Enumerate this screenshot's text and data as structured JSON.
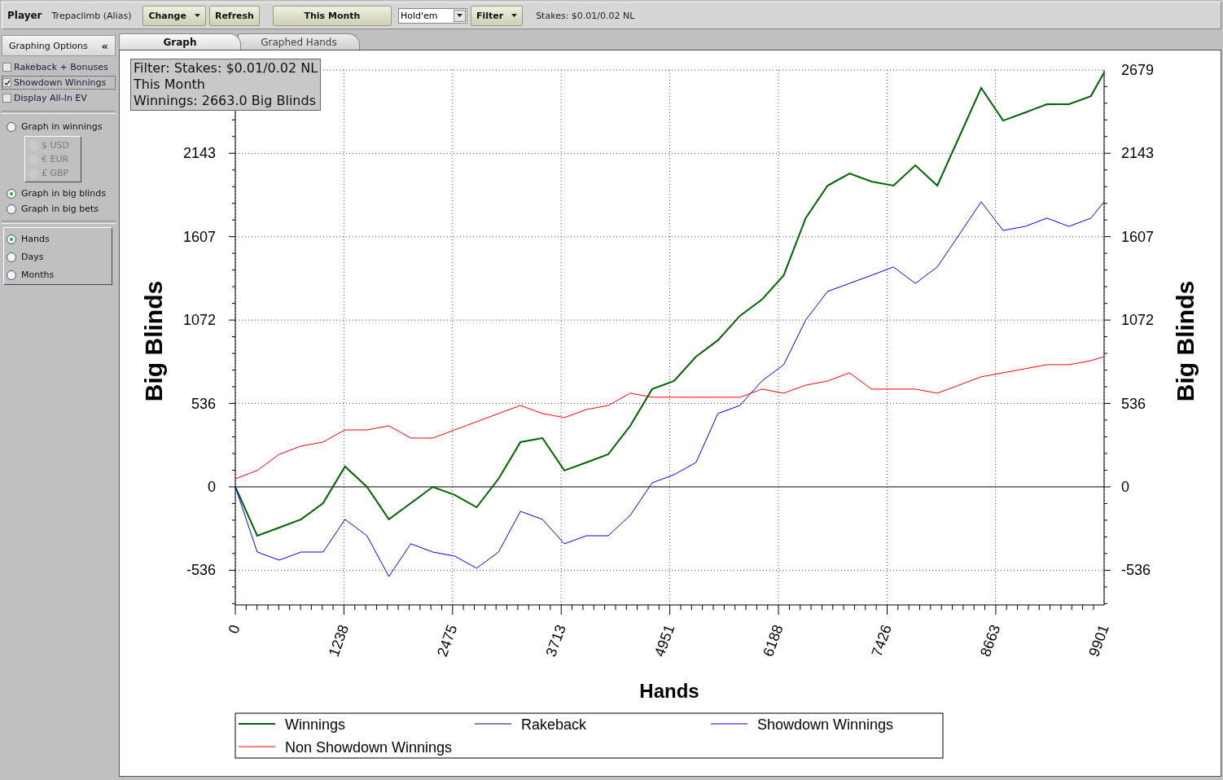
{
  "toolbar": {
    "player_label": "Player",
    "player_name": "Trepaclimb (Alias)",
    "buttons": [
      {
        "label": "Change",
        "dropdown": true
      },
      {
        "label": "Refresh",
        "dropdown": false
      }
    ],
    "period_button": "This Month",
    "game_select": "Hold'em",
    "filter_button": "Filter",
    "stakes": "Stakes: $0.01/0.02 NL"
  },
  "sidebar": {
    "title": "Graphing Options",
    "collapse_icon": "«",
    "checkboxes": [
      {
        "label": "Rakeback + Bonuses",
        "checked": false,
        "focused": false
      },
      {
        "label": "Showdown Winnings",
        "checked": true,
        "focused": true
      },
      {
        "label": "Display All-In EV",
        "checked": false,
        "focused": false
      }
    ],
    "unit_options": [
      {
        "label": "Graph in winnings",
        "selected": false,
        "currencies": [
          {
            "label": "$ USD",
            "selected": false
          },
          {
            "label": "€ EUR",
            "selected": false
          },
          {
            "label": "£ GBP",
            "selected": false
          }
        ],
        "currencies_disabled": true
      },
      {
        "label": "Graph in big blinds",
        "selected": true
      },
      {
        "label": "Graph in big bets",
        "selected": false
      }
    ],
    "axis_options": [
      {
        "label": "Hands",
        "selected": true
      },
      {
        "label": "Days",
        "selected": false
      },
      {
        "label": "Months",
        "selected": false
      }
    ]
  },
  "tabs": [
    {
      "label": "Graph",
      "selected": true
    },
    {
      "label": "Graphed Hands",
      "selected": false
    }
  ],
  "graph": {
    "info_box": [
      "Filter: Stakes: $0.01/0.02 NL",
      "This Month",
      "Winnings: 2663.0 Big Blinds"
    ],
    "right_axis_title": "Big Blinds",
    "right_yticks": [
      "2679",
      "2143",
      "1607",
      "1072",
      "536",
      "0",
      "-536"
    ],
    "chart_data": {
      "type": "line",
      "xlabel": "Hands",
      "ylabel": "Big Blinds",
      "grid": true,
      "legend": true,
      "x": [
        0,
        250,
        500,
        750,
        1000,
        1250,
        1500,
        1750,
        2000,
        2250,
        2500,
        2750,
        3000,
        3250,
        3500,
        3750,
        4000,
        4250,
        4500,
        4750,
        5000,
        5250,
        5500,
        5750,
        6000,
        6250,
        6500,
        6750,
        7000,
        7250,
        7500,
        7750,
        8000,
        8250,
        8500,
        8750,
        9000,
        9250,
        9500,
        9750,
        9901
      ],
      "series": [
        {
          "name": "Winnings",
          "color": "#006400",
          "values": [
            0,
            -314,
            -262,
            -209,
            -105,
            131,
            0,
            -209,
            -105,
            0,
            -52,
            -131,
            52,
            288,
            314,
            105,
            157,
            209,
            392,
            628,
            680,
            837,
            942,
            1099,
            1203,
            1360,
            1727,
            1936,
            2014,
            1962,
            1936,
            2067,
            1936,
            2250,
            2564,
            2354,
            2406,
            2459,
            2459,
            2511,
            2663
          ]
        },
        {
          "name": "Rakeback",
          "color": "#000080",
          "values": [
            null,
            null,
            null,
            null,
            null,
            null,
            null,
            null,
            null,
            null,
            null,
            null,
            null,
            null,
            null,
            null,
            null,
            null,
            null,
            null,
            null,
            null,
            null,
            null,
            null,
            null,
            null,
            null,
            null,
            null,
            null,
            null,
            null,
            null,
            null,
            null,
            null,
            null,
            null,
            null,
            null
          ]
        },
        {
          "name": "Showdown Winnings",
          "color": "#0000ff",
          "values": [
            0,
            -419,
            -471,
            -419,
            -419,
            -209,
            -314,
            -576,
            -366,
            -419,
            -445,
            -523,
            -419,
            -157,
            -209,
            -366,
            -314,
            -314,
            -183,
            26,
            78,
            157,
            471,
            523,
            680,
            785,
            1072,
            1256,
            1308,
            1360,
            1413,
            1308,
            1413,
            1622,
            1832,
            1648,
            1674,
            1727,
            1674,
            1727,
            1832
          ]
        },
        {
          "name": "Non Showdown Winnings",
          "color": "#ff0000",
          "values": [
            52,
            105,
            209,
            262,
            288,
            366,
            366,
            392,
            314,
            314,
            366,
            419,
            471,
            523,
            471,
            445,
            497,
            523,
            602,
            576,
            576,
            576,
            576,
            576,
            628,
            602,
            654,
            680,
            733,
            628,
            628,
            628,
            602,
            654,
            707,
            733,
            759,
            785,
            785,
            811,
            837
          ]
        }
      ],
      "xlim": [
        0,
        9901
      ],
      "ylim": [
        -759,
        2679
      ],
      "xticks": [
        {
          "value": 0,
          "label": "0"
        },
        {
          "value": 1238,
          "label": "1238"
        },
        {
          "value": 2475,
          "label": "2475"
        },
        {
          "value": 3713,
          "label": "3713"
        },
        {
          "value": 4951,
          "label": "4951"
        },
        {
          "value": 6188,
          "label": "6188"
        },
        {
          "value": 7426,
          "label": "7426"
        },
        {
          "value": 8663,
          "label": "8663"
        },
        {
          "value": 9901,
          "label": "9901"
        }
      ],
      "yticks": [
        2679,
        {
          "value": 2143,
          "label": "2143"
        },
        {
          "value": 1607,
          "label": "1607"
        },
        {
          "value": 1072,
          "label": "1072"
        },
        {
          "value": 536,
          "label": "536"
        },
        {
          "value": 0,
          "label": "0"
        },
        {
          "value": -536,
          "label": "-536"
        }
      ]
    }
  }
}
